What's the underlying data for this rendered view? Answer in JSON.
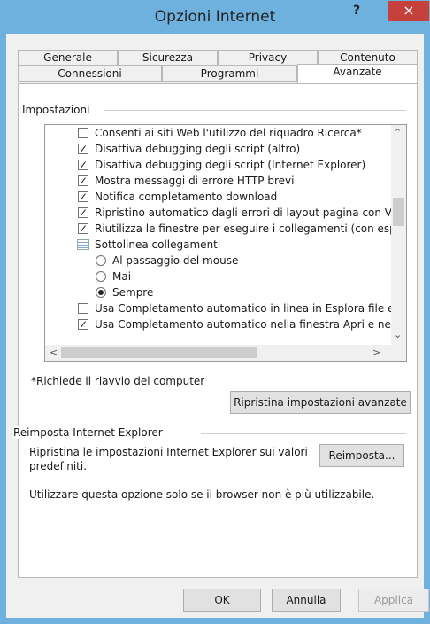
{
  "window": {
    "title": "Opzioni Internet",
    "help": "?",
    "close": "×"
  },
  "tabs_row1": [
    "Generale",
    "Sicurezza",
    "Privacy",
    "Contenuto"
  ],
  "tabs_row2": [
    "Connessioni",
    "Programmi",
    "Avanzate"
  ],
  "impostazioni": {
    "label": "Impostazioni",
    "items": [
      {
        "type": "checkbox",
        "checked": false,
        "label": "Consenti ai siti Web l'utilizzo del riquadro Ricerca*"
      },
      {
        "type": "checkbox",
        "checked": true,
        "label": "Disattiva debugging degli script (altro)"
      },
      {
        "type": "checkbox",
        "checked": true,
        "label": "Disattiva debugging degli script (Internet Explorer)"
      },
      {
        "type": "checkbox",
        "checked": true,
        "label": "Mostra messaggi di errore HTTP brevi"
      },
      {
        "type": "checkbox",
        "checked": true,
        "label": "Notifica completamento download"
      },
      {
        "type": "checkbox",
        "checked": true,
        "label": "Ripristino automatico dagli errori di layout pagina con Visua"
      },
      {
        "type": "checkbox",
        "checked": true,
        "label": "Riutilizza le finestre per eseguire i collegamenti (con esplor"
      },
      {
        "type": "folder",
        "label": "Sottolinea collegamenti"
      },
      {
        "type": "radio",
        "checked": false,
        "label": "Al passaggio del mouse"
      },
      {
        "type": "radio",
        "checked": false,
        "label": "Mai"
      },
      {
        "type": "radio",
        "checked": true,
        "label": "Sempre"
      },
      {
        "type": "checkbox",
        "checked": false,
        "label": "Usa Completamento automatico in linea in Esplora file e fin"
      },
      {
        "type": "checkbox",
        "checked": true,
        "label": "Usa Completamento automatico nella finestra Apri e nella l"
      }
    ],
    "note": "*Richiede il riavvio del computer",
    "reset_advanced_button": "Ripristina impostazioni avanzate"
  },
  "reimposta": {
    "label": "Reimposta Internet Explorer",
    "description_line1": "Ripristina le impostazioni Internet Explorer sui valori",
    "description_line2": "predefiniti.",
    "button": "Reimposta...",
    "warning": "Utilizzare questa opzione solo se il browser non è più utilizzabile."
  },
  "footer": {
    "ok": "OK",
    "cancel": "Annulla",
    "apply": "Applica"
  }
}
